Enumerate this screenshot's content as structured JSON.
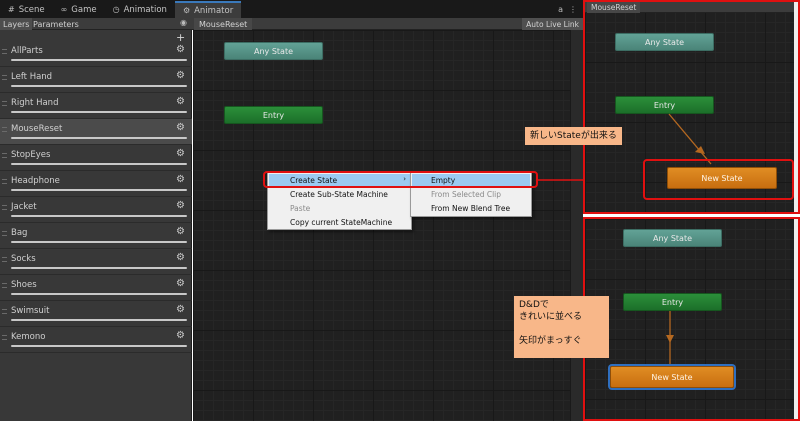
{
  "tabs": [
    {
      "icon": "#",
      "label": "Scene",
      "active": false
    },
    {
      "icon": "∞",
      "label": "Game",
      "active": false
    },
    {
      "icon": "◷",
      "label": "Animation",
      "active": false
    },
    {
      "icon": "⚙",
      "label": "Animator",
      "active": true
    }
  ],
  "toolbar": {
    "layers_tab": "Layers",
    "parameters_tab": "Parameters",
    "breadcrumb": "MouseReset",
    "live_link": "Auto Live Link"
  },
  "layers": [
    {
      "name": "AllParts"
    },
    {
      "name": "Left Hand"
    },
    {
      "name": "Right Hand"
    },
    {
      "name": "MouseReset",
      "selected": true
    },
    {
      "name": "StopEyes"
    },
    {
      "name": "Headphone"
    },
    {
      "name": "Jacket"
    },
    {
      "name": "Bag"
    },
    {
      "name": "Socks"
    },
    {
      "name": "Shoes"
    },
    {
      "name": "Swimsuit"
    },
    {
      "name": "Kemono"
    }
  ],
  "graph": {
    "any_state": "Any State",
    "entry": "Entry"
  },
  "context_menu": {
    "items": [
      "Create State",
      "Create Sub-State Machine",
      "Paste",
      "Copy current StateMachine"
    ],
    "submenu": [
      "Empty",
      "From Selected Clip",
      "From New Blend Tree"
    ]
  },
  "panel_top": {
    "breadcrumb": "MouseReset",
    "any_state": "Any State",
    "entry": "Entry",
    "new_state": "New State",
    "callout": "新しいStateが出来る"
  },
  "panel_bottom": {
    "any_state": "Any State",
    "entry": "Entry",
    "new_state": "New State",
    "callout_lines": [
      "D&Dで",
      "きれいに並べる",
      "",
      "矢印がまっすぐ"
    ]
  },
  "colors": {
    "highlight_red": "#e01010",
    "callout_bg": "#f8b789",
    "any_state": "#5a9488",
    "entry": "#237f32",
    "new_state": "#d87d1a",
    "menu_highlight": "#9bcaf1"
  }
}
